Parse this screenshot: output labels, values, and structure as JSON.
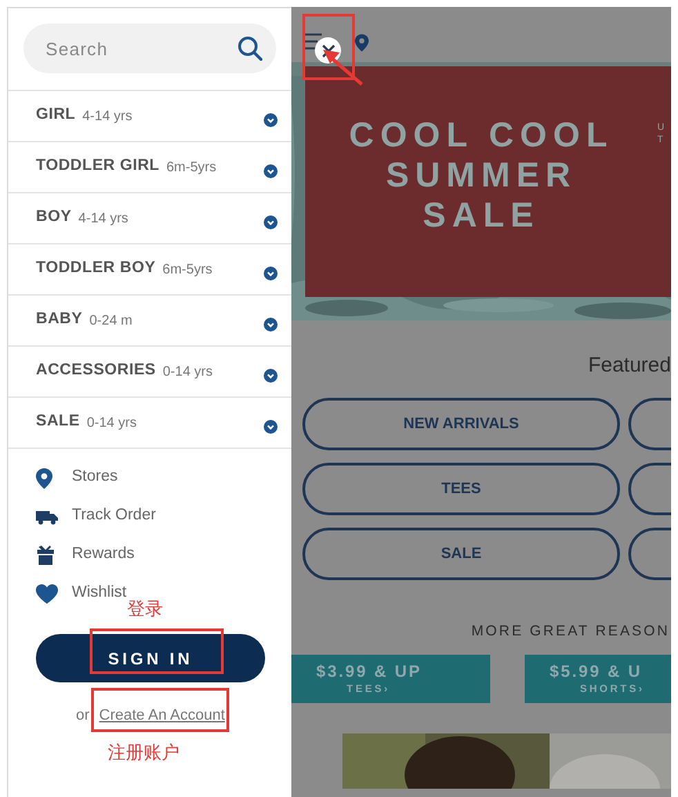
{
  "sidebar": {
    "search": {
      "placeholder": "Search"
    },
    "categories": [
      {
        "label": "GIRL",
        "ages": "4-14 yrs"
      },
      {
        "label": "TODDLER GIRL",
        "ages": "6m-5yrs"
      },
      {
        "label": "BOY",
        "ages": "4-14 yrs"
      },
      {
        "label": "TODDLER BOY",
        "ages": "6m-5yrs"
      },
      {
        "label": "BABY",
        "ages": "0-24 m"
      },
      {
        "label": "ACCESSORIES",
        "ages": "0-14 yrs"
      },
      {
        "label": "SALE",
        "ages": "0-14 yrs"
      }
    ],
    "links": [
      {
        "kind": "pin",
        "label": "Stores"
      },
      {
        "kind": "truck",
        "label": "Track Order"
      },
      {
        "kind": "gift",
        "label": "Rewards"
      },
      {
        "kind": "heart",
        "label": "Wishlist"
      }
    ],
    "sign_in": "SIGN IN",
    "or": "or",
    "create_account": "Create An Account"
  },
  "page": {
    "hero": {
      "title_lines": [
        "COOL COOL",
        "SUMMER",
        "SALE"
      ],
      "side_text": [
        "U",
        "T"
      ]
    },
    "featured": "Featured",
    "pills": [
      "NEW ARRIVALS",
      "TEES",
      "SALE"
    ],
    "reasons_title": "MORE GREAT REASON",
    "deals": [
      {
        "price": "$3.99 & UP",
        "item": "TEES›"
      },
      {
        "price": "$5.99 & U",
        "item": "SHORTS›"
      }
    ]
  },
  "annotations": [
    {
      "text": "登录"
    },
    {
      "text": "注册账户"
    }
  ]
}
